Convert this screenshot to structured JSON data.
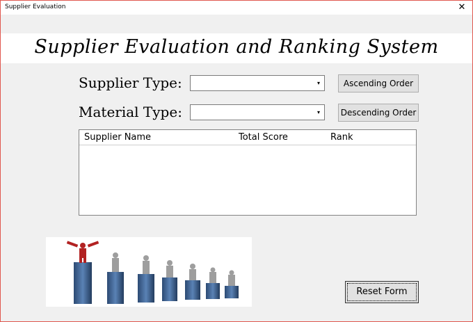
{
  "window": {
    "title": "Supplier Evaluation",
    "close_glyph": "✕"
  },
  "banner": {
    "title": "Supplier Evaluation and Ranking System"
  },
  "form": {
    "supplier_type_label": "Supplier Type:",
    "supplier_type_value": "",
    "material_type_label": "Material Type:",
    "material_type_value": "",
    "dropdown_glyph": "▾"
  },
  "buttons": {
    "ascending": "Ascending Order",
    "descending": "Descending Order",
    "reset": "Reset Form"
  },
  "list": {
    "columns": [
      "Supplier Name",
      "Total Score",
      "Rank"
    ],
    "rows": []
  },
  "picture": {
    "icon": "podium-ranking-figures-icon",
    "leader_color": "#b22222",
    "bar_color": "#3a5f8f"
  }
}
